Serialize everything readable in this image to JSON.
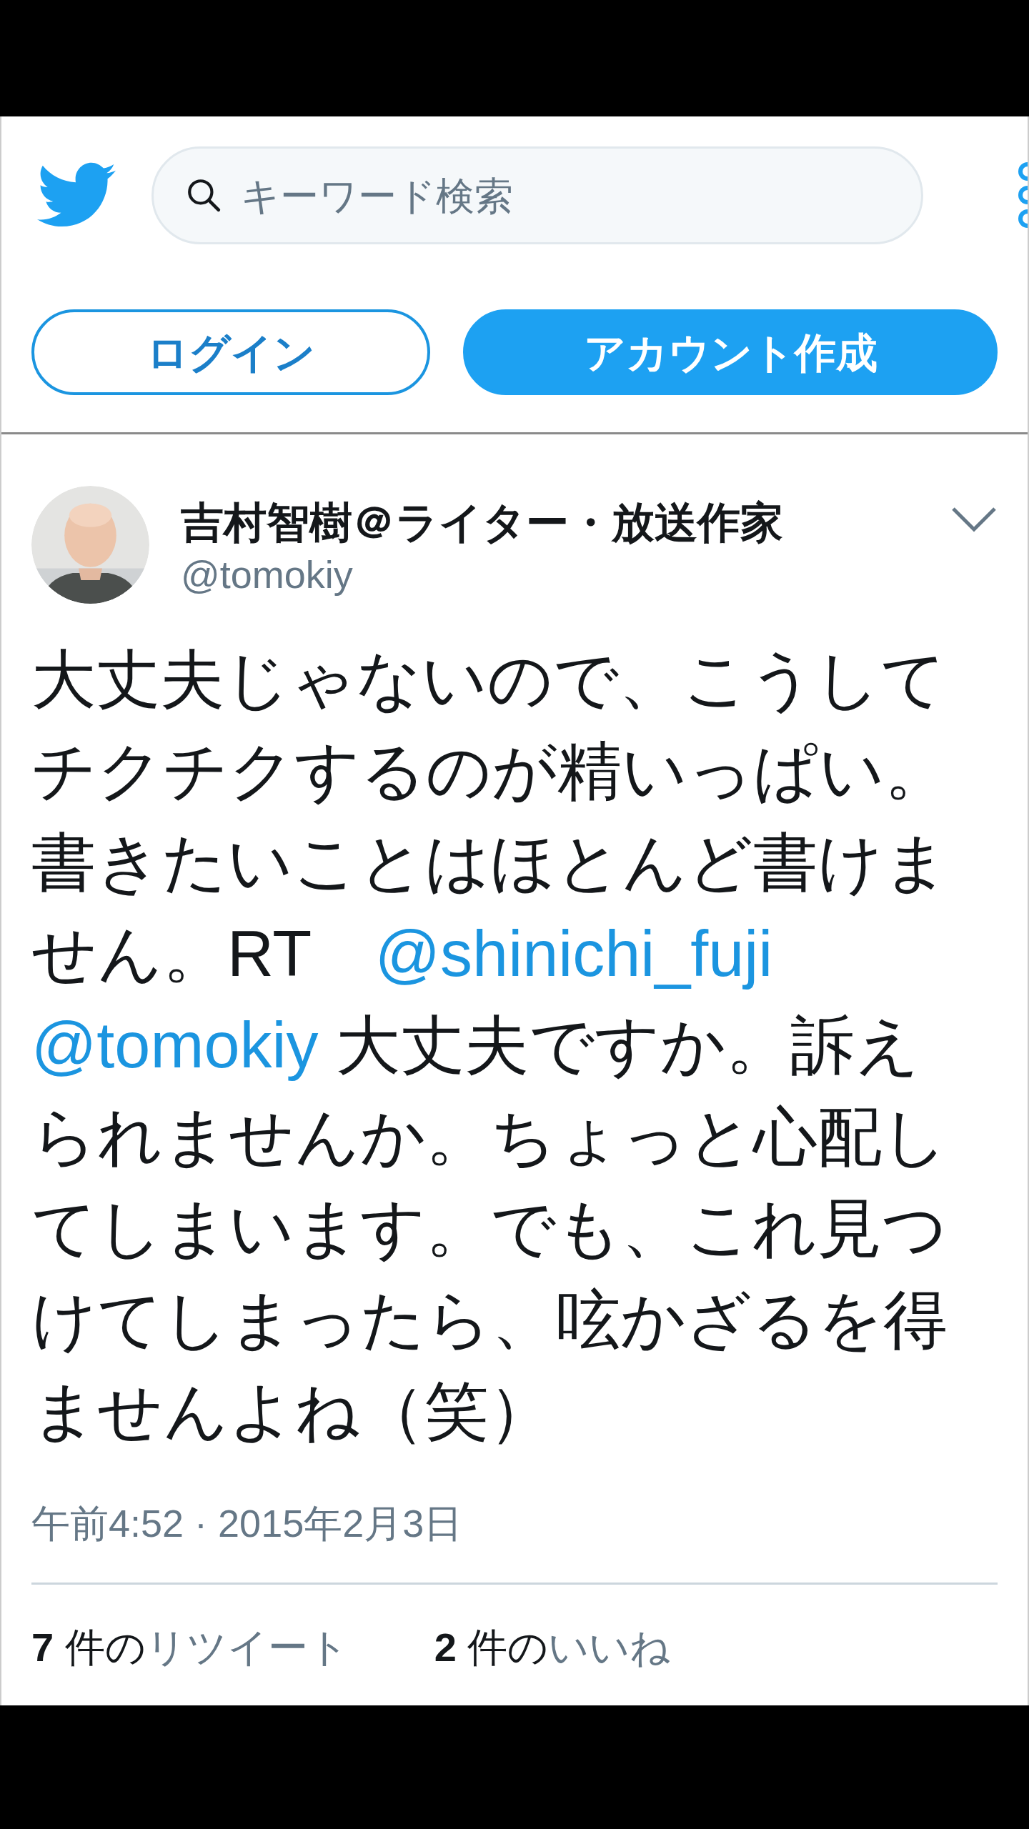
{
  "header": {
    "search": {
      "placeholder": "キーワード検索"
    },
    "buttons": [
      {
        "label": "ログイン",
        "kind": "outline"
      },
      {
        "label": "アカウント作成",
        "kind": "filled"
      }
    ]
  },
  "tweet": {
    "author": {
      "name": "吉村智樹＠ライター・放送作家",
      "handle": "@tomokiy"
    },
    "body": [
      {
        "kind": "text",
        "text": "大丈夫じゃないので、こうしてチクチクするのが精いっぱい。書きたいことはほとんど書けません。RT　"
      },
      {
        "kind": "mention",
        "text": "@shinichi_fuji"
      },
      {
        "kind": "mention",
        "text": "@tomokiy"
      },
      {
        "kind": "text",
        "text": " 大丈夫ですか。訴えられませんか。ちょっと心配してしまいます。でも、これ見つけてしまったら、呟かざるを得ませんよね（笑）"
      }
    ],
    "timestamp": "午前4:52 · 2015年2月3日",
    "stats": [
      {
        "count": "7",
        "unit": "件の",
        "label": "リツイート"
      },
      {
        "count": "2",
        "unit": "件の",
        "label": "いいね"
      }
    ]
  }
}
